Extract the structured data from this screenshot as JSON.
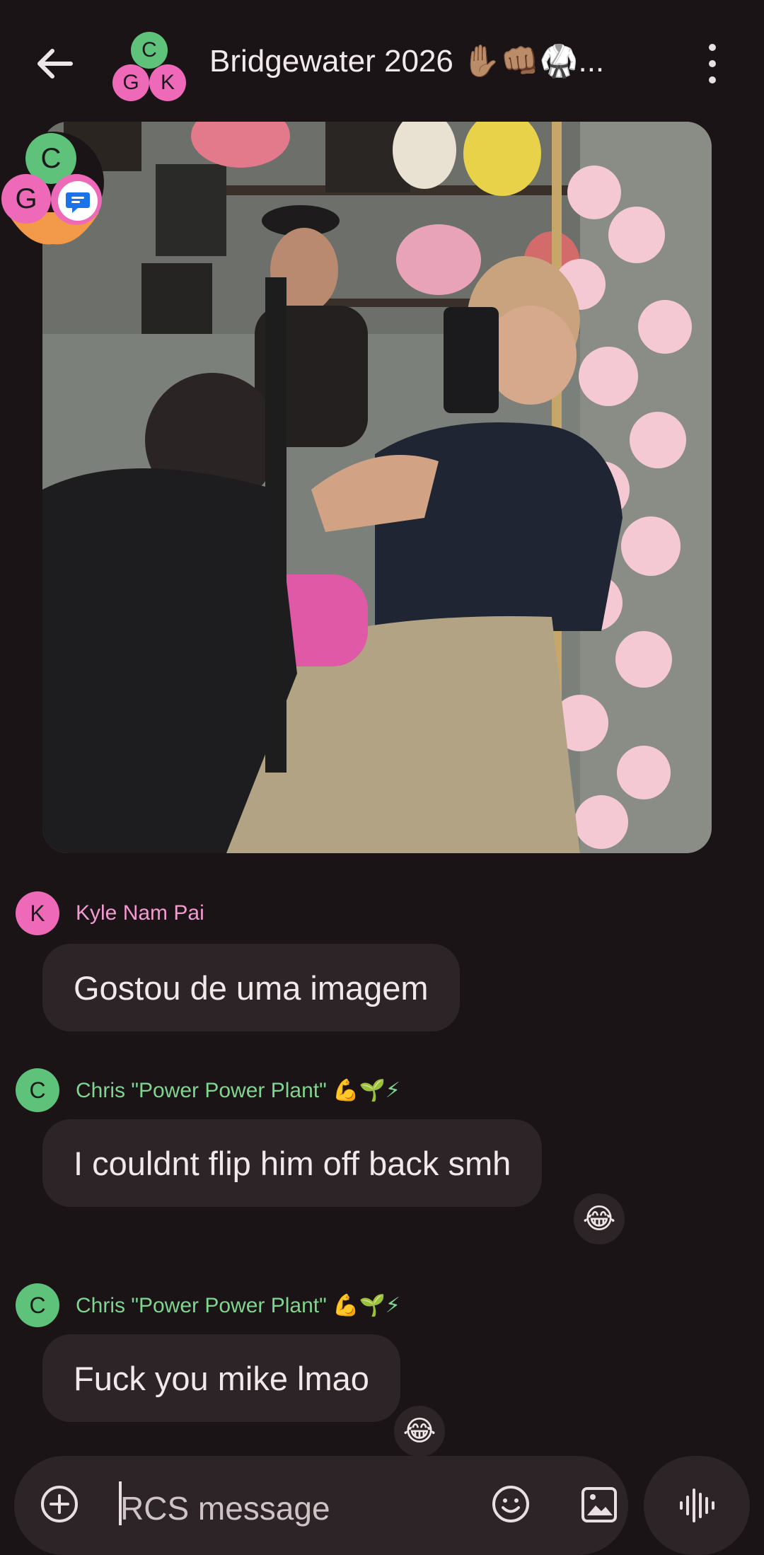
{
  "header": {
    "title": "Bridgewater 2026 ✋🏽👊🏽🥋...",
    "avatar_initials": [
      "C",
      "G",
      "K"
    ]
  },
  "photo_avatar_initials": [
    "C",
    "G"
  ],
  "messages": [
    {
      "sender_initial": "K",
      "sender": "Kyle Nam Pai",
      "text": "Gostou de uma imagem",
      "reaction": ""
    },
    {
      "sender_initial": "C",
      "sender": "Chris \"Power Power Plant\" 💪🌱⚡",
      "text": "I couldnt flip him off back smh",
      "reaction": "😂"
    },
    {
      "sender_initial": "C",
      "sender": "Chris \"Power Power Plant\" 💪🌱⚡",
      "text": "Fuck you mike lmao",
      "reaction": "😂"
    }
  ],
  "composer": {
    "placeholder": "RCS message"
  },
  "colors": {
    "background": "#1b1416",
    "bubble": "#2c2426",
    "avatar_green": "#5ec27a",
    "avatar_pink": "#ee6ab9",
    "name_pink": "#f39ad0",
    "name_green": "#7fd48f"
  }
}
